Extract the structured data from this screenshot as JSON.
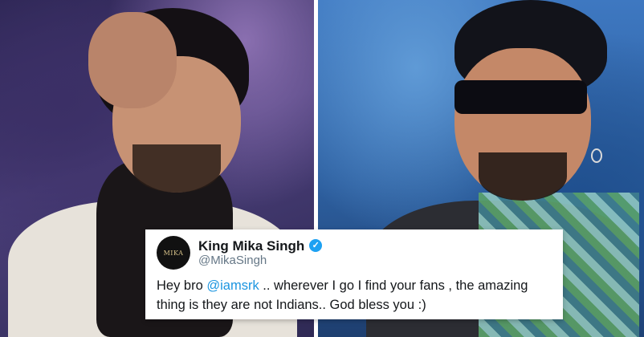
{
  "photos": {
    "left": {
      "description_icon": "person-photo"
    },
    "right": {
      "description_icon": "person-photo"
    }
  },
  "tweet": {
    "avatar_text": "MIKA",
    "display_name": "King Mika Singh",
    "verified_icon": "verified-badge-icon",
    "handle": "@MikaSingh",
    "text_before": "Hey bro ",
    "mention": "@iamsrk",
    "text_after": " .. wherever I go I find your fans , the amazing thing is they are not Indians.. God bless you :)"
  },
  "colors": {
    "verified": "#1da1f2",
    "mention": "#1b95e0",
    "handle": "#657786"
  }
}
